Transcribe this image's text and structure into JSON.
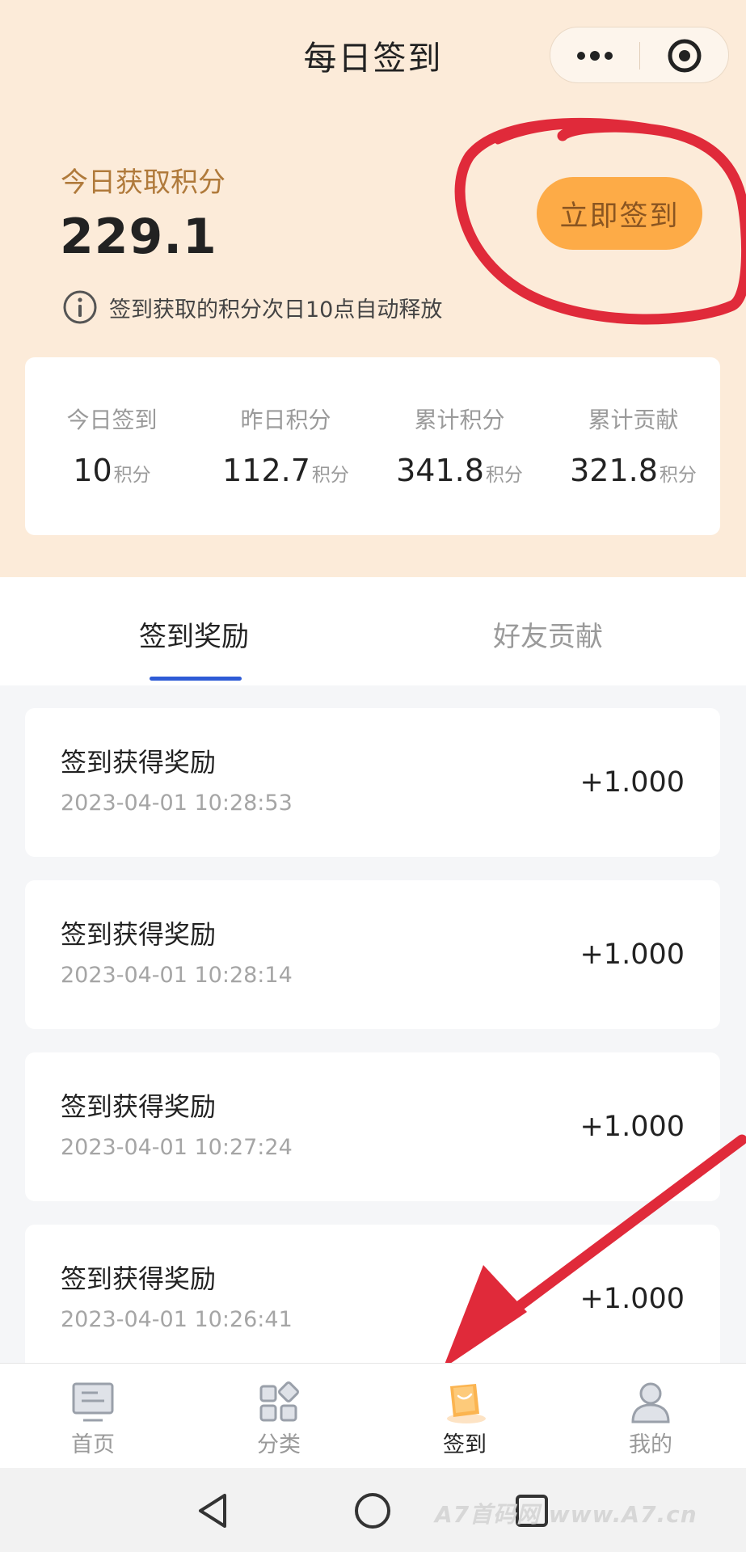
{
  "header": {
    "title": "每日签到",
    "more_icon": "more-dots-icon",
    "close_icon": "target-circle-icon"
  },
  "summary": {
    "today_label": "今日获取积分",
    "today_value": "229.1",
    "info_icon": "info-icon",
    "info_text": "签到获取的积分次日10点自动释放",
    "sign_button_label": "立即签到"
  },
  "stats": [
    {
      "label": "今日签到",
      "value": "10",
      "unit": "积分"
    },
    {
      "label": "昨日积分",
      "value": "112.7",
      "unit": "积分"
    },
    {
      "label": "累计积分",
      "value": "341.8",
      "unit": "积分"
    },
    {
      "label": "累计贡献",
      "value": "321.8",
      "unit": "积分"
    }
  ],
  "tabs": [
    {
      "label": "签到奖励",
      "active": true
    },
    {
      "label": "好友贡献",
      "active": false
    }
  ],
  "records": [
    {
      "title": "签到获得奖励",
      "time": "2023-04-01 10:28:53",
      "amount": "+1.000"
    },
    {
      "title": "签到获得奖励",
      "time": "2023-04-01 10:28:14",
      "amount": "+1.000"
    },
    {
      "title": "签到获得奖励",
      "time": "2023-04-01 10:27:24",
      "amount": "+1.000"
    },
    {
      "title": "签到获得奖励",
      "time": "2023-04-01 10:26:41",
      "amount": "+1.000"
    }
  ],
  "bottom_nav": [
    {
      "label": "首页",
      "icon": "monitor-icon",
      "active": false
    },
    {
      "label": "分类",
      "icon": "grid-icon",
      "active": false
    },
    {
      "label": "签到",
      "icon": "sign-in-icon",
      "active": true
    },
    {
      "label": "我的",
      "icon": "user-icon",
      "active": false
    }
  ],
  "system_nav": {
    "back_icon": "back-triangle-icon",
    "home_icon": "home-circle-icon",
    "recent_icon": "recent-square-icon"
  },
  "watermark": "A7首码网 www.A7.cn",
  "colors": {
    "header_bg": "#fcebd9",
    "accent": "#fdab47",
    "tab_underline": "#2e5bd6",
    "annotation_red": "#e02a3a"
  }
}
